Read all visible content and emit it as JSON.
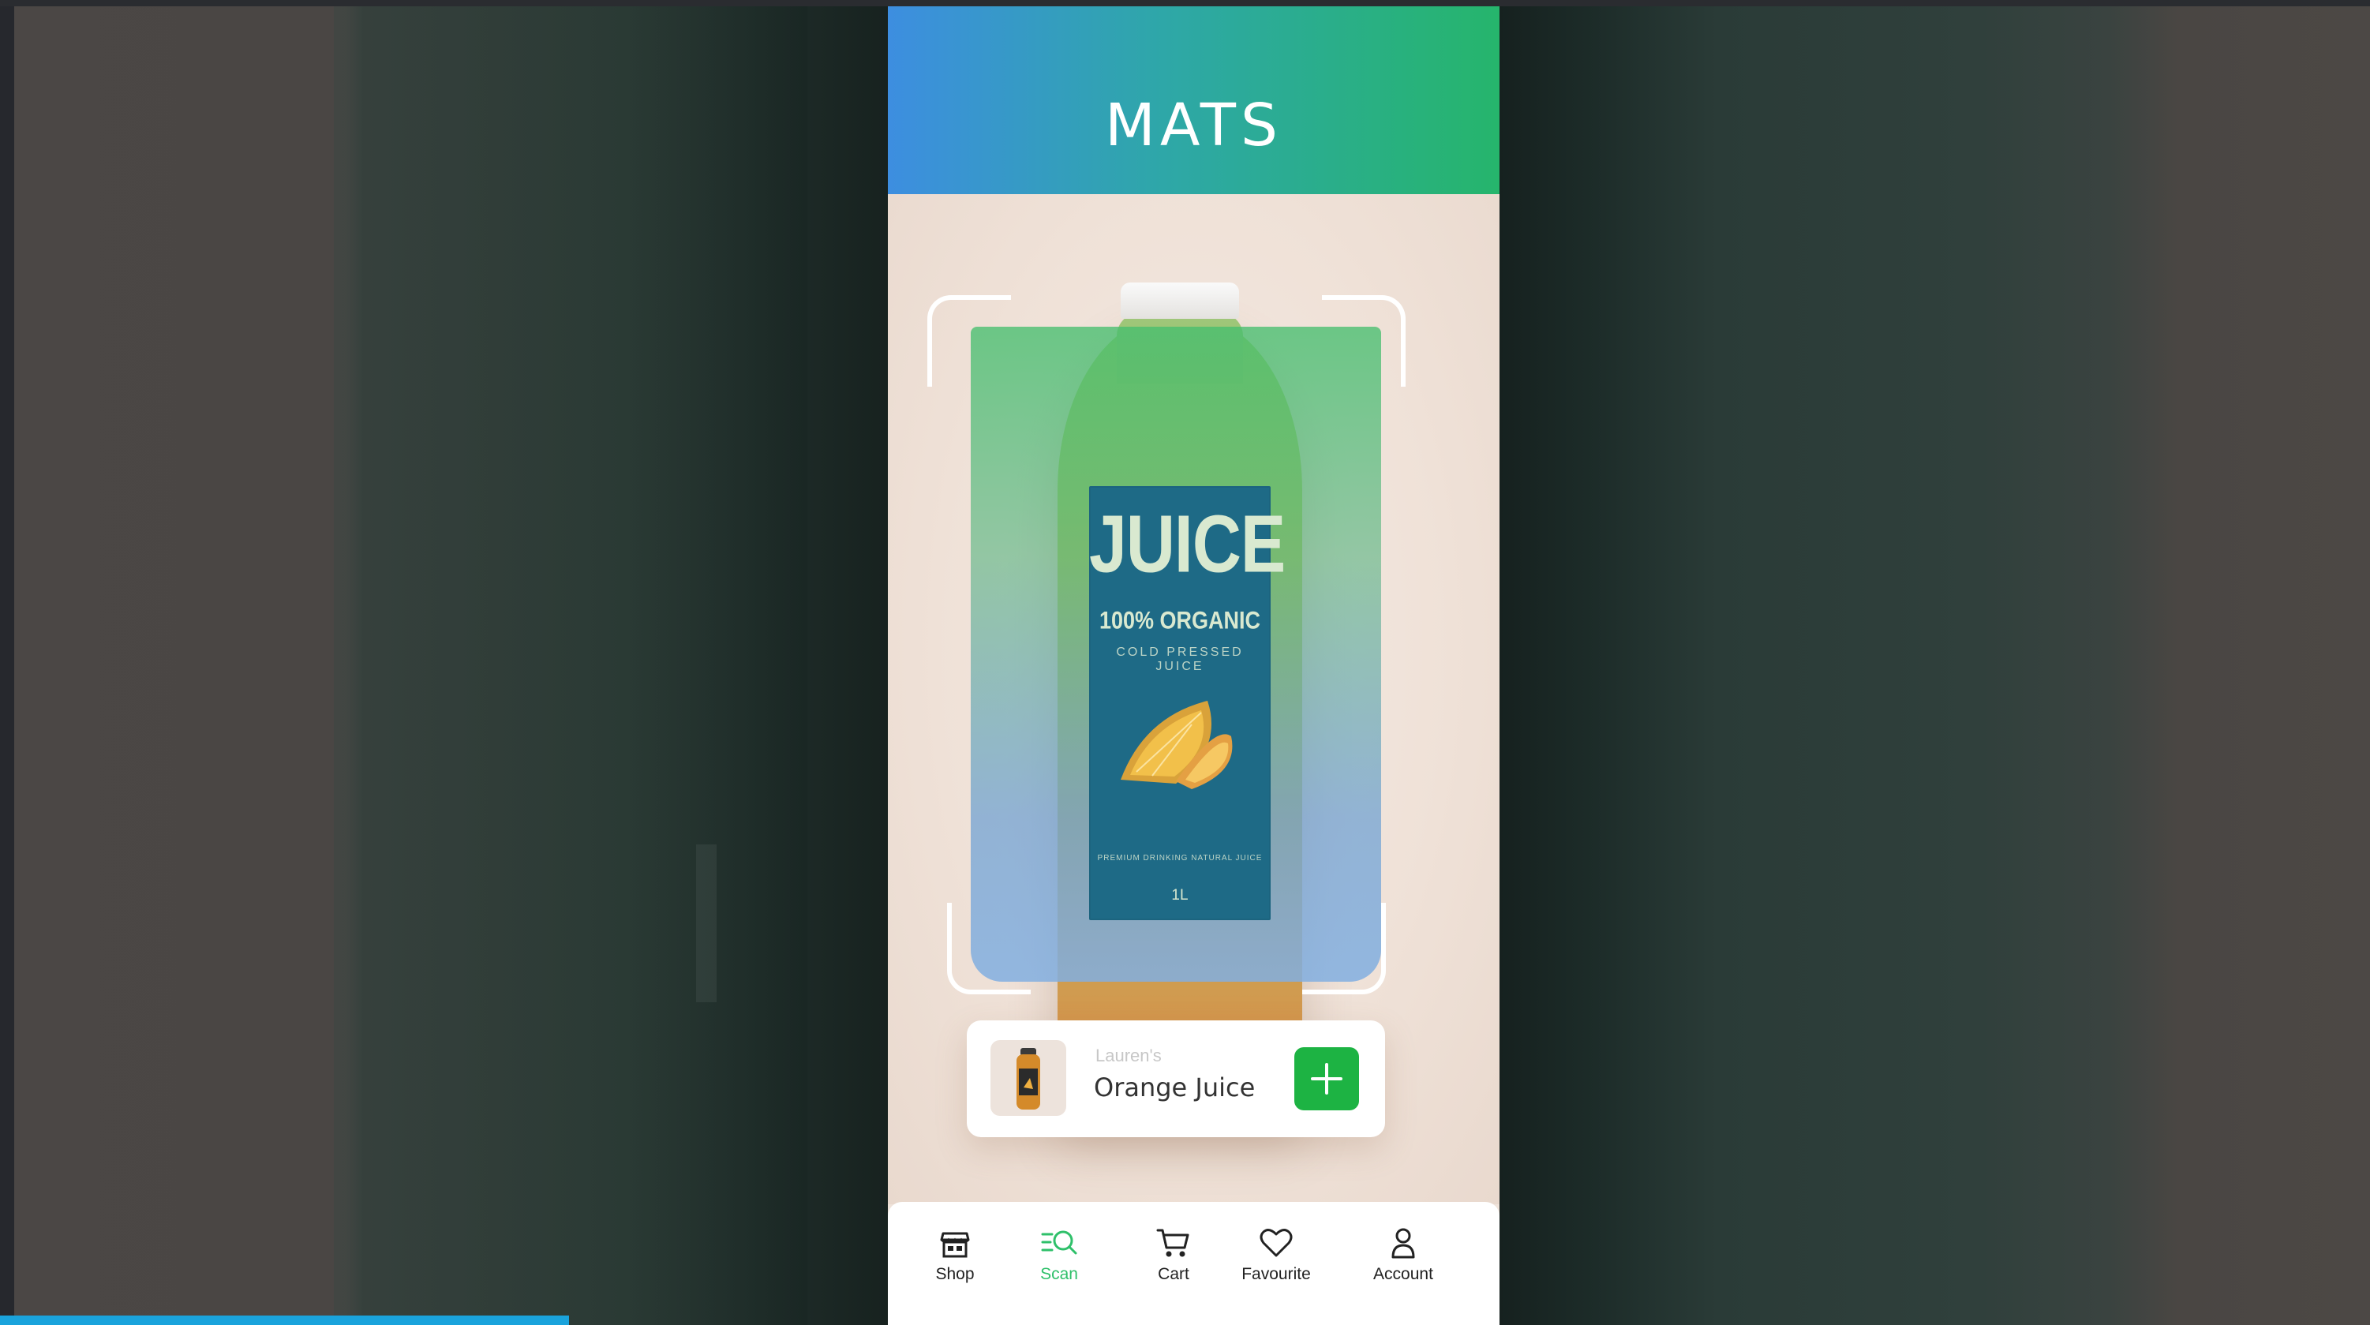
{
  "app": {
    "title": "MATS"
  },
  "scan": {
    "product_label": {
      "title": "JUICE",
      "subtitle": "100% ORGANIC",
      "tagline": "COLD PRESSED JUICE",
      "fine_print": "PREMIUM DRINKING NATURAL JUICE",
      "volume": "1L"
    }
  },
  "product_card": {
    "brand": "Lauren's",
    "name": "Orange Juice",
    "add_icon": "plus-icon"
  },
  "bottom_nav": {
    "items": [
      {
        "label": "Shop",
        "icon": "store-icon"
      },
      {
        "label": "Scan",
        "icon": "scan-icon"
      },
      {
        "label": "Cart",
        "icon": "cart-icon"
      },
      {
        "label": "Favourite",
        "icon": "heart-icon"
      },
      {
        "label": "Account",
        "icon": "user-icon"
      }
    ],
    "active": "Scan"
  },
  "colors": {
    "header_gradient_start": "#3d8ee0",
    "header_gradient_end": "#26b56c",
    "accent_green": "#1db343",
    "active_nav": "#2fc06a",
    "progress_bar": "#1aa3dc"
  },
  "video_progress": 0.24
}
